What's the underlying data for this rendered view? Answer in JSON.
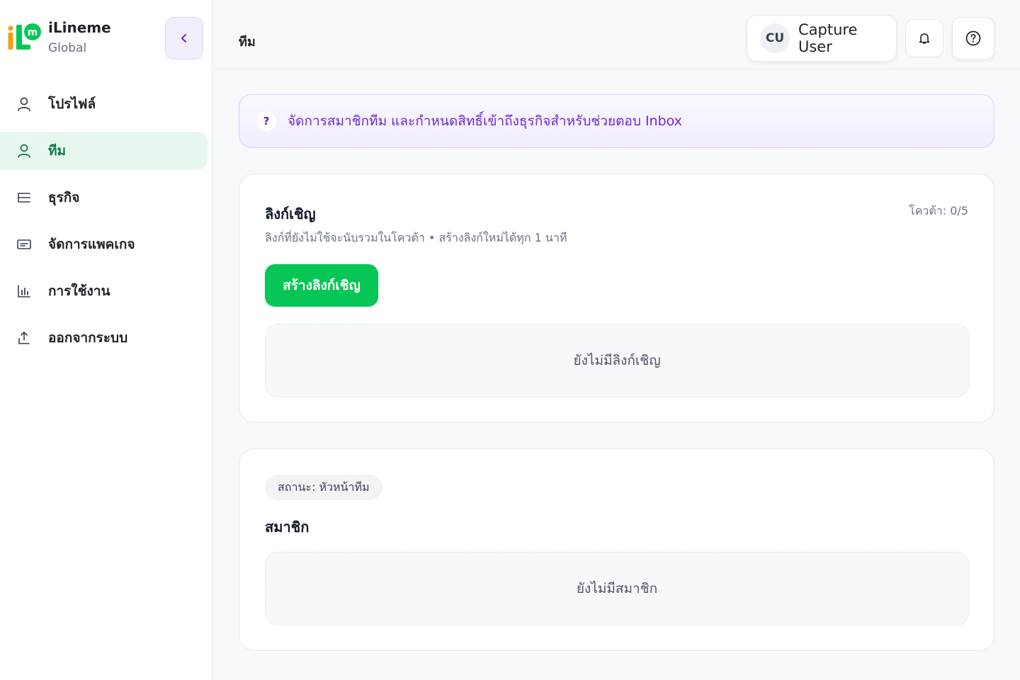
{
  "brand": {
    "name": "iLineme",
    "subtitle": "Global"
  },
  "sidebar": {
    "items": [
      {
        "label": "โปรไฟล์",
        "icon": "user-icon",
        "active": false
      },
      {
        "label": "ทีม",
        "icon": "user-icon",
        "active": true
      },
      {
        "label": "ธุรกิจ",
        "icon": "list-icon",
        "active": false
      },
      {
        "label": "จัดการแพคเกจ",
        "icon": "card-icon",
        "active": false
      },
      {
        "label": "การใช้งาน",
        "icon": "bar-chart-icon",
        "active": false
      },
      {
        "label": "ออกจากระบบ",
        "icon": "logout-icon",
        "active": false
      }
    ]
  },
  "header": {
    "title": "ทีม",
    "user": {
      "initials": "CU",
      "name": "Capture User"
    }
  },
  "banner": {
    "icon": "?",
    "text": "จัดการสมาชิกทีม และกำหนดสิทธิ์เข้าถึงธุรกิจสำหรับช่วยตอบ Inbox"
  },
  "invite": {
    "title": "ลิงก์เชิญ",
    "quota": "โควต้า: 0/5",
    "subtitle": "ลิงก์ที่ยังไม่ใช้จะนับรวมในโควต้า • สร้างลิงก์ใหม่ได้ทุก 1 นาที",
    "create_button": "สร้างลิงก์เชิญ",
    "empty_text": "ยังไม่มีลิงก์เชิญ"
  },
  "members": {
    "status": "สถานะ: หัวหน้าทีม",
    "title": "สมาชิก",
    "empty_text": "ยังไม่มีสมาชิก"
  },
  "colors": {
    "accent_green": "#06c755",
    "active_nav_bg": "#e8f7ed",
    "banner_purple": "#6d28d9"
  }
}
